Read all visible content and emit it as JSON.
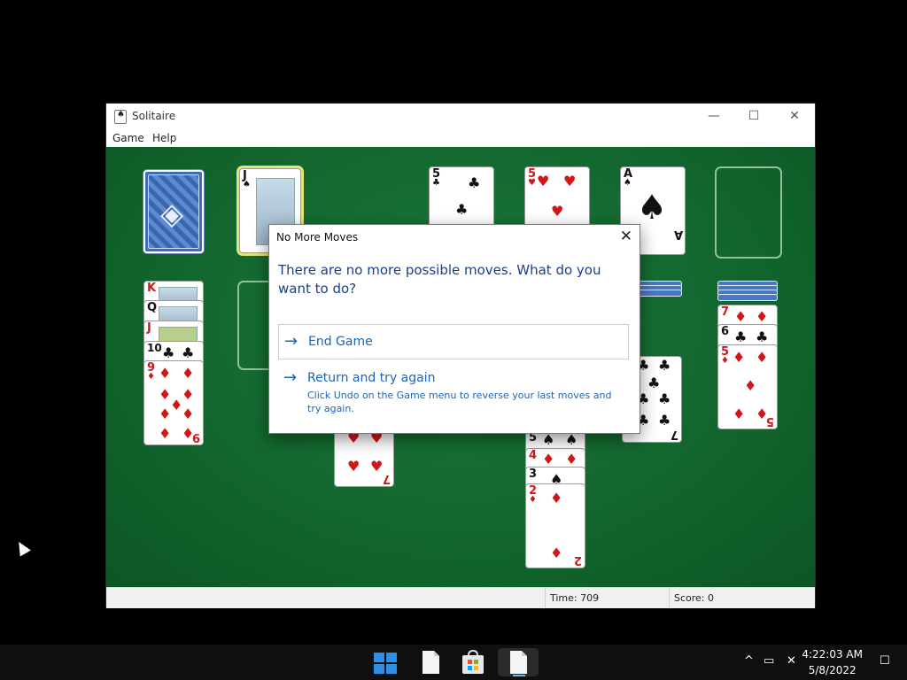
{
  "window": {
    "title": "Solitaire",
    "minimize_glyph": "—",
    "maximize_glyph": "☐",
    "close_glyph": "✕",
    "menu": [
      "Game",
      "Help"
    ]
  },
  "status": {
    "time_label": "Time:",
    "time_value": "709",
    "score_label": "Score:",
    "score_value": "0"
  },
  "waste_card": {
    "rank": "J",
    "suit": "♠"
  },
  "foundations": [
    {
      "rank": "5",
      "suit": "♣"
    },
    {
      "rank": "5",
      "suit": "♥"
    },
    {
      "rank": "A",
      "suit": "♠"
    }
  ],
  "tableau_1": [
    {
      "rank": "K",
      "suit": "♣"
    },
    {
      "rank": "Q",
      "suit": "♦"
    },
    {
      "rank": "J",
      "suit": "♥"
    },
    {
      "rank": "10",
      "suit": "♣"
    },
    {
      "rank": "9",
      "suit": "♦",
      "rank_br": "9"
    }
  ],
  "tableau_3_bottom": {
    "rank_br": "7",
    "suit": "♥"
  },
  "tableau_5_cards": [
    {
      "rank": "5",
      "suit": "♠"
    },
    {
      "rank": "4",
      "suit": "♦"
    },
    {
      "rank": "3",
      "suit": "♠"
    },
    {
      "rank": "2",
      "suit": "♦",
      "rank_br": "2"
    }
  ],
  "tableau_6_bottom": {
    "rank_br": "7",
    "suit": "♣"
  },
  "tableau_7": [
    {
      "rank": "7",
      "suit": "♦"
    },
    {
      "rank": "6",
      "suit": "♣"
    },
    {
      "rank": "5",
      "suit": "♦",
      "rank_br": "5"
    }
  ],
  "dialog": {
    "title": "No More Moves",
    "close_glyph": "✕",
    "message": "There are no more possible moves. What do you want to do?",
    "end_game_label": "End Game",
    "retry_label": "Return and try again",
    "retry_description": "Click Undo on the Game menu to reverse your last moves and try again.",
    "arrow_glyph": "→"
  },
  "taskbar": {
    "time": "4:22:03 AM",
    "date": "5/8/2022",
    "icons": [
      "start-icon",
      "file-icon",
      "store-icon",
      "file-icon"
    ],
    "tray_chevron": "^",
    "notification_glyph": "☐"
  },
  "colors": {
    "felt": "#146a30",
    "dialog_text": "#1c64b4",
    "card_red": "#d01818"
  }
}
